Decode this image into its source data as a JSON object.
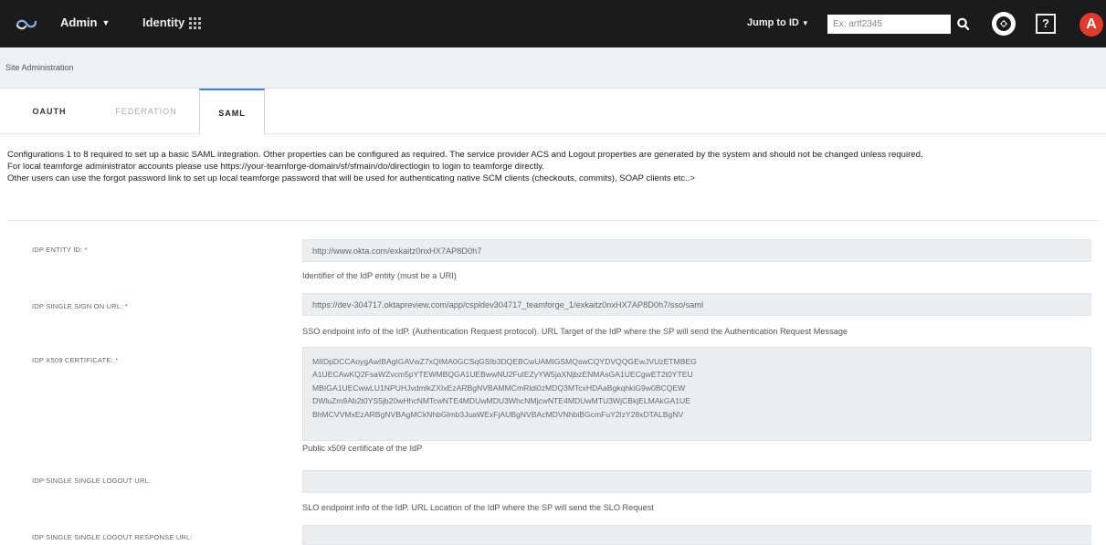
{
  "topbar": {
    "admin_label": "Admin",
    "identity_label": "Identity",
    "jump_label": "Jump to ID",
    "search_placeholder": "Ex: artf2345",
    "help_label": "?",
    "avatar_letter": "A",
    "accent_color": "#e03a2e",
    "icons": [
      "teamforge-logo-icon",
      "chevron-down-icon",
      "grid-icon",
      "search-icon",
      "menu-circle-icon",
      "help-icon"
    ]
  },
  "breadcrumb": {
    "label": "Site Administration"
  },
  "tabs": [
    {
      "label": "OAUTH",
      "active": false
    },
    {
      "label": "FEDERATION",
      "active": false
    },
    {
      "label": "SAML",
      "active": true
    }
  ],
  "intro": {
    "line1": "Configurations 1 to 8 required to set up a basic SAML integration. Other properties can be configured as required. The service provider ACS and Logout properties are generated by the system and should not be changed unless required.",
    "line2": "For local teamforge administrator accounts please use https://your-teamforge-domain/sf/sfmain/do/directlogin to login to teamforge directly.",
    "line3": "Other users can use the forgot password link to set up local teamforge password that will be used for authenticating native SCM clients (checkouts, commits), SOAP clients etc..>"
  },
  "form": {
    "entity_id": {
      "label": "IDP ENTITY ID:",
      "required_mark": "*",
      "value": "http://www.okta.com/exkaitz0nxHX7AP8D0h7",
      "hint": "Identifier of the IdP entity (must be a URI)"
    },
    "sso_url": {
      "label": "IDP SINGLE SIGN ON URL:",
      "required_mark": "*",
      "value": "https://dev-304717.oktapreview.com/app/cspldev304717_teamforge_1/exkaitz0nxHX7AP8D0h7/sso/saml",
      "hint": "SSO endpoint info of the IdP. (Authentication Request protocol). URL Target of the IdP where the SP will send the Authentication Request Message"
    },
    "certificate": {
      "label": "IDP X509 CERTIFICATE:",
      "required_mark": "*",
      "lines": [
        "MIIDpDCCAoygAwIBAgIGAVwZ7xQIMA0GCSqGSIb3DQEBCwUAMIGSMQswCQYDVQQGEwJVUzETMBEG",
        "A1UECAwKQ2FsaWZvcm5pYTEWMBQGA1UEBwwNU2FuIEZyYW5jaXNjbzENMAsGA1UECgwET2t0YTEU",
        "MBIGA1UECwwLU1NPUHJvdmlkZXIxEzARBgNVBAMMCmRldi0zMDQ3MTcxHDAaBgkqhkiG9w0BCQEW",
        "DWluZm9Ab2t0YS5jb20wHhcNMTcwNTE4MDUwMDU3WhcNMjcwNTE4MDUwMTU3WjCBkjELMAkGA1UE",
        "BhMCVVMxEzARBgNVBAgMCkNhbGlmb3JuaWExFjAUBgNVBAcMDVNhbiBGcmFuY2lzY28xDTALBgNV"
      ],
      "hint": "Public x509 certificate of the IdP"
    },
    "slo_url": {
      "label": "IDP SINGLE SINGLE LOGOUT URL:",
      "value": "",
      "hint": "SLO endpoint info of the IdP. URL Location of the IdP where the SP will send the SLO Request"
    },
    "slo_response_url": {
      "label": "IDP SINGLE SINGLE LOGOUT RESPONSE URL:",
      "value": ""
    }
  }
}
